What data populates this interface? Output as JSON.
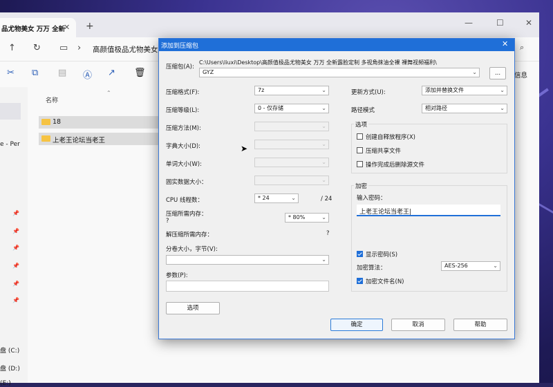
{
  "explorer": {
    "tab_title": "品尤物美女 万万 全新",
    "breadcrumb": "高颜值极品尤物美女",
    "info_label": "信息",
    "sidebar_items": [
      "e - Per",
      "盘 (C:)",
      "盘 (D:)",
      "(E:)"
    ],
    "column_name": "名称",
    "files": [
      "18",
      "上老王论坛当老王"
    ]
  },
  "dialog": {
    "title": "添加到压缩包",
    "close": "✕",
    "archive_label": "压缩包(A):",
    "archive_path": "C:\\Users\\liuxi\\Desktop\\高颜值极品尤物美女 万万 全新露脸定制 多视角抹油全裸 裸舞视频福利\\",
    "archive_name": "GYZ",
    "browse_label": "...",
    "format_label": "压缩格式(F):",
    "format_value": "7z",
    "level_label": "压缩等级(L):",
    "level_value": "0 - 仅存储",
    "method_label": "压缩方法(M):",
    "dict_label": "字典大小(D):",
    "word_label": "单词大小(W):",
    "solid_label": "固实数据大小：",
    "cpu_label": "CPU 线程数：",
    "cpu_value": "* 24",
    "cpu_total": "/ 24",
    "mem_comp_label": "压缩所需内存：",
    "mem_comp_q": "?",
    "mem_percent": "* 80%",
    "mem_decomp_label": "解压缩所需内存：",
    "mem_decomp_q": "?",
    "split_label": "分卷大小，字节(V):",
    "params_label": "参数(P):",
    "options_btn": "选项",
    "update_label": "更新方式(U):",
    "update_value": "添加并替换文件",
    "path_label": "路径模式",
    "path_value": "相对路径",
    "options_group": "选项",
    "opt_sfx": "创建自释放程序(X)",
    "opt_shared": "压缩共享文件",
    "opt_delete": "操作完成后删除源文件",
    "encrypt_group": "加密",
    "pwd_label": "输入密码：",
    "pwd_value": "上老王论坛当老王|",
    "show_pwd": "显示密码(S)",
    "enc_method_label": "加密算法：",
    "enc_method_value": "AES-256",
    "enc_names": "加密文件名(N)",
    "ok": "确定",
    "cancel": "取消",
    "help": "帮助"
  }
}
